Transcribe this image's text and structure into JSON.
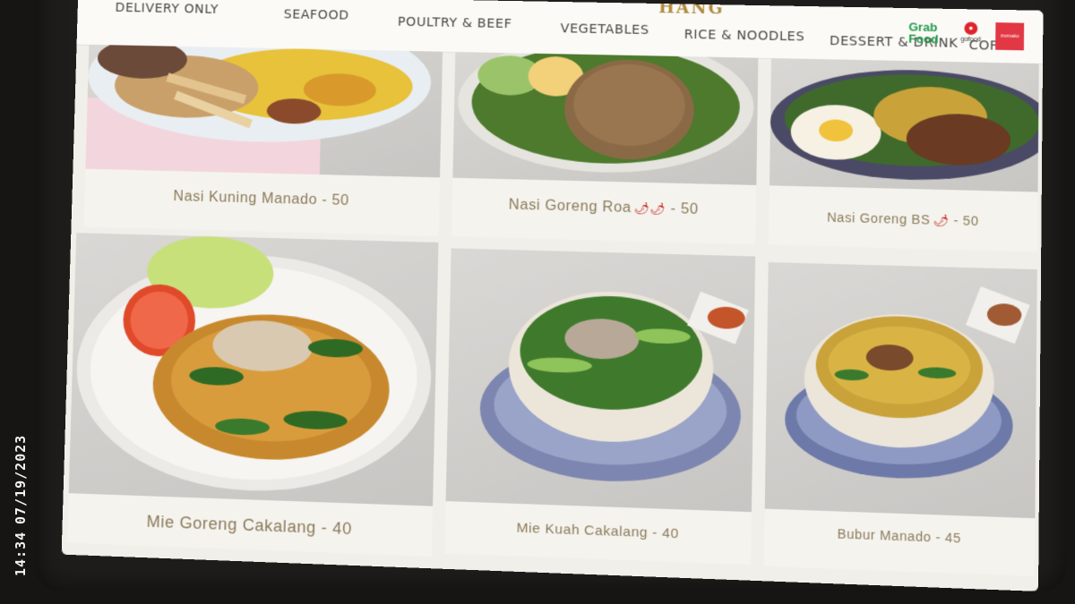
{
  "overlay": {
    "date": "07/19/2023",
    "time": "14:34"
  },
  "nav": {
    "items": [
      "DELIVERY ONLY",
      "SEAFOOD",
      "POULTRY & BEEF",
      "VEGETABLES",
      "RICE & NOODLES",
      "DESSERT & DRINK",
      "COFFEE"
    ],
    "brand_partial": "HANG",
    "delivery": {
      "grab": "Grab\nFood",
      "gofood": "gofood",
      "zomato": "zomato"
    }
  },
  "menu": [
    {
      "name": "Nasi Kuning Manado",
      "price": "50",
      "chili": ""
    },
    {
      "name": "Nasi Goreng Roa",
      "price": "50",
      "chili": "🌶🌶"
    },
    {
      "name": "Nasi Goreng BS",
      "price": "50",
      "chili": "🌶"
    },
    {
      "name": "Mie Goreng Cakalang",
      "price": "40",
      "chili": ""
    },
    {
      "name": "Mie Kuah Cakalang",
      "price": "40",
      "chili": ""
    },
    {
      "name": "Bubur Manado",
      "price": "45",
      "chili": ""
    }
  ],
  "colors": {
    "caption": "#8a7a5a",
    "chili": "#c41f1a",
    "grab": "#1f9a4a",
    "zomato": "#e23744"
  }
}
